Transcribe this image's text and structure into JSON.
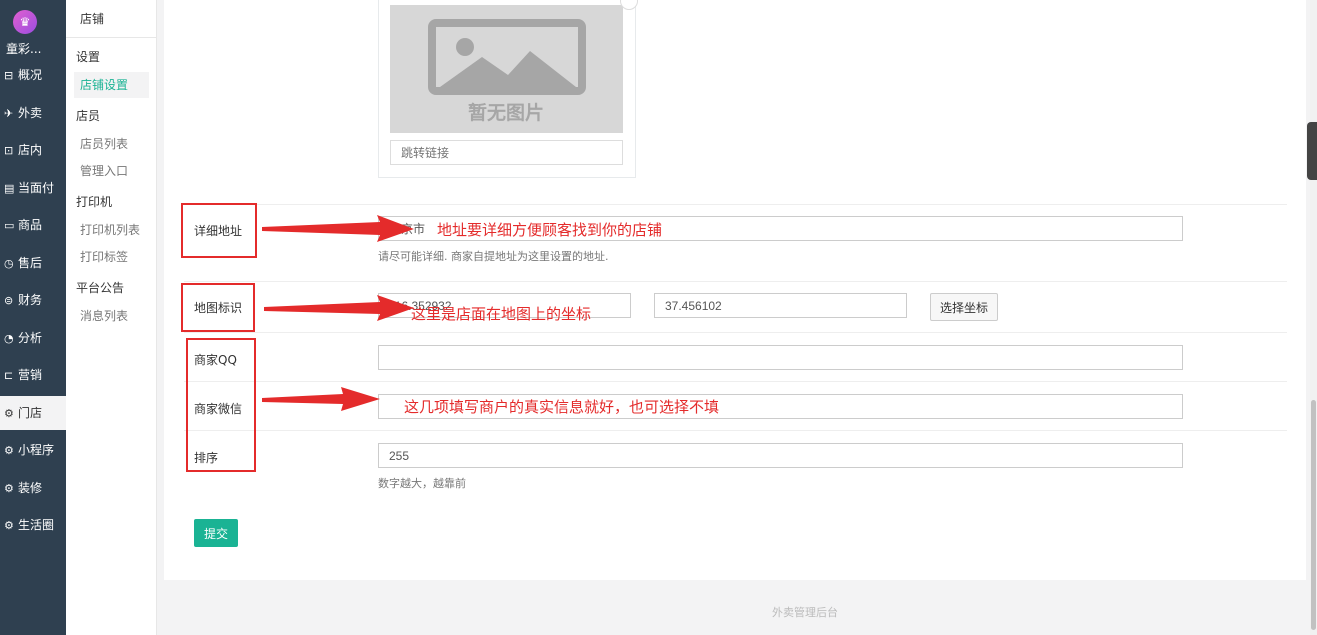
{
  "nav": {
    "store_name": "童彩...",
    "items": [
      {
        "label": "概况",
        "icon": "overview-icon",
        "glyph": "⊟",
        "active": false
      },
      {
        "label": "外卖",
        "icon": "delivery-icon",
        "glyph": "✈",
        "active": false
      },
      {
        "label": "店内",
        "icon": "store-icon",
        "glyph": "⊡",
        "active": false
      },
      {
        "label": "当面付",
        "icon": "pay-icon",
        "glyph": "▤",
        "active": false
      },
      {
        "label": "商品",
        "icon": "goods-icon",
        "glyph": "▭",
        "active": false
      },
      {
        "label": "售后",
        "icon": "after-sale-icon",
        "glyph": "◷",
        "active": false
      },
      {
        "label": "财务",
        "icon": "finance-icon",
        "glyph": "⊜",
        "active": false
      },
      {
        "label": "分析",
        "icon": "analysis-icon",
        "glyph": "◔",
        "active": false
      },
      {
        "label": "营销",
        "icon": "marketing-icon",
        "glyph": "⊏",
        "active": false
      },
      {
        "label": "门店",
        "icon": "gear-icon",
        "glyph": "⚙",
        "active": true
      },
      {
        "label": "小程序",
        "icon": "gear-icon",
        "glyph": "⚙",
        "active": false
      },
      {
        "label": "装修",
        "icon": "gear-icon",
        "glyph": "⚙",
        "active": false
      },
      {
        "label": "生活圈",
        "icon": "gear-icon",
        "glyph": "⚙",
        "active": false
      }
    ]
  },
  "subnav": {
    "header": "店铺",
    "groups": [
      {
        "title": "设置",
        "items": [
          {
            "label": "店铺设置",
            "active": true
          }
        ]
      },
      {
        "title": "店员",
        "items": [
          {
            "label": "店员列表",
            "active": false
          },
          {
            "label": "管理入口",
            "active": false
          }
        ]
      },
      {
        "title": "打印机",
        "items": [
          {
            "label": "打印机列表",
            "active": false
          },
          {
            "label": "打印标签",
            "active": false
          }
        ]
      },
      {
        "title": "平台公告",
        "items": [
          {
            "label": "消息列表",
            "active": false
          }
        ]
      }
    ]
  },
  "image_upload": {
    "placeholder_text": "暂无图片",
    "link_placeholder": "跳转链接"
  },
  "form": {
    "address": {
      "label": "详细地址",
      "value": "北京市",
      "hint": "请尽可能详细. 商家自提地址为这里设置的地址."
    },
    "map": {
      "label": "地图标识",
      "lng": "116.352932",
      "lat": "37.456102",
      "button": "选择坐标"
    },
    "qq": {
      "label": "商家QQ",
      "value": ""
    },
    "wechat": {
      "label": "商家微信",
      "value": ""
    },
    "sort": {
      "label": "排序",
      "value": "255",
      "hint": "数字越大，越靠前"
    },
    "submit": "提交"
  },
  "annotations": {
    "address": "地址要详细方便顾客找到你的店铺",
    "map": "这里是店面在地图上的坐标",
    "info": "这几项填写商户的真实信息就好，也可选择不填"
  },
  "colors": {
    "accent": "#1ab394",
    "annotation": "#e42b2b",
    "sidebar": "#2f4050"
  },
  "footer": "外卖管理后台"
}
